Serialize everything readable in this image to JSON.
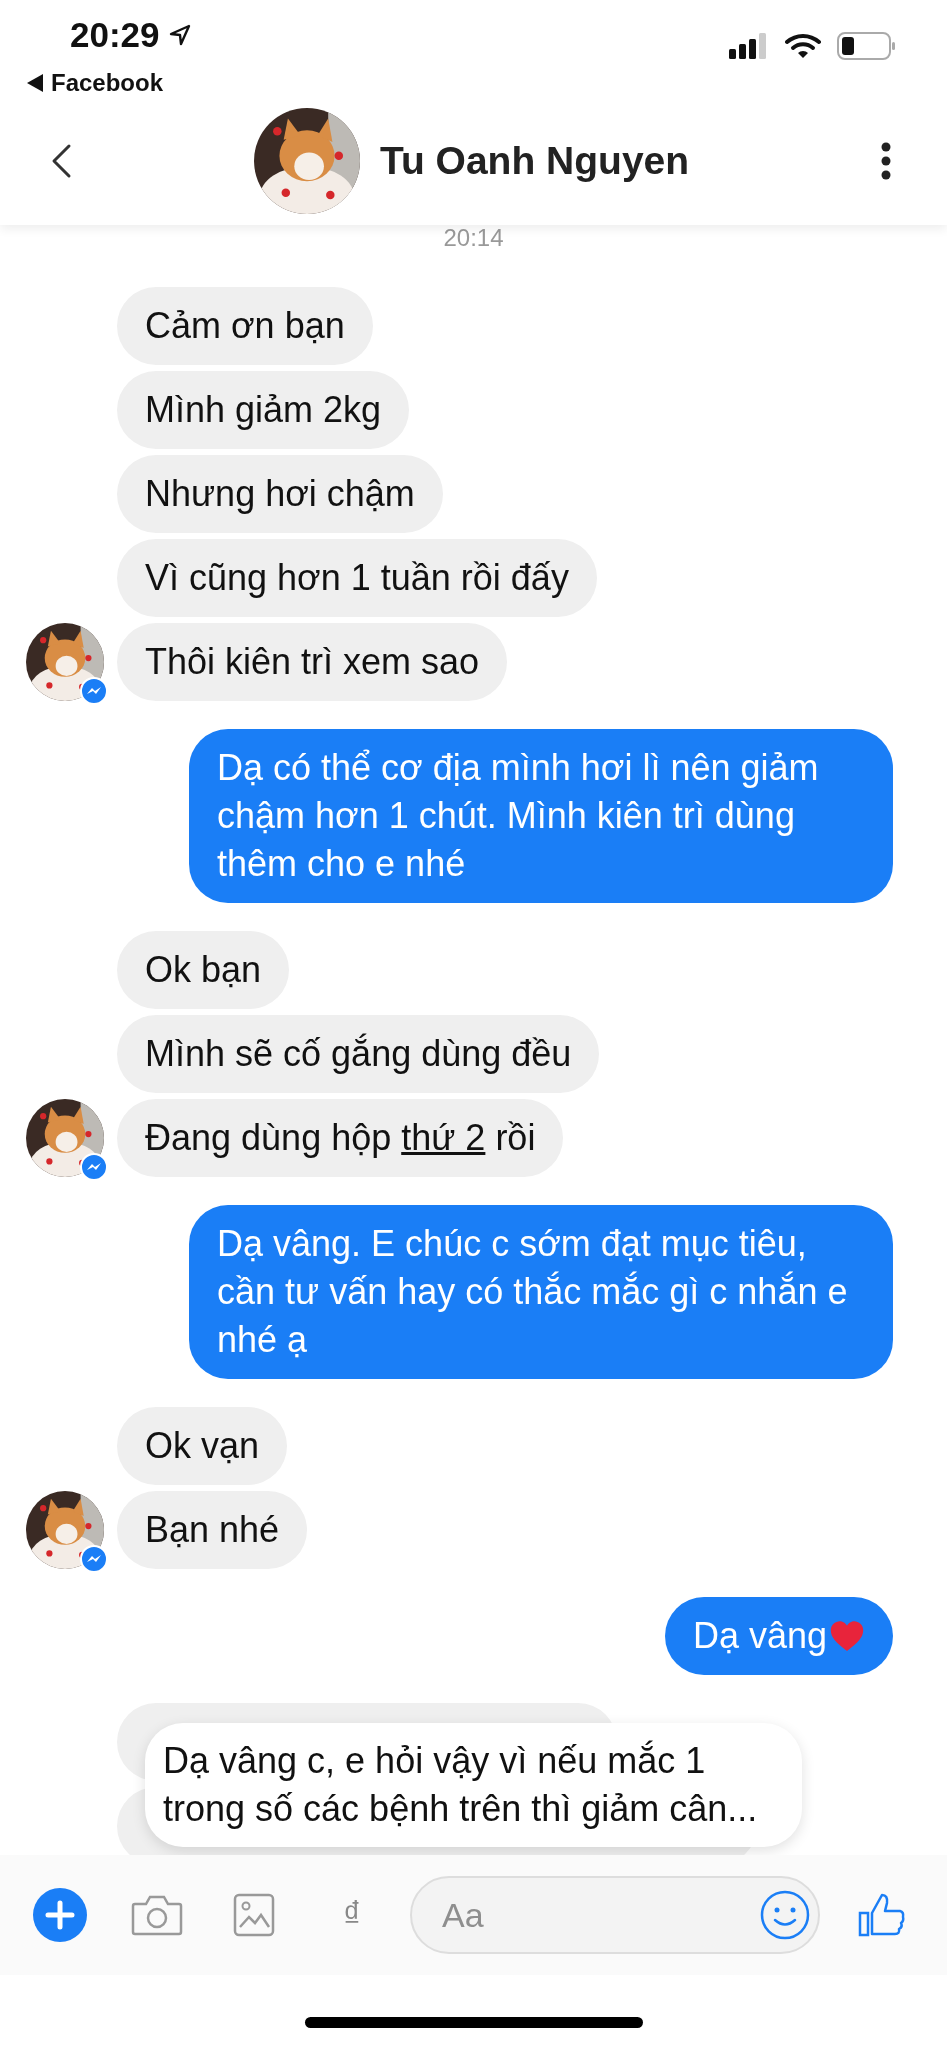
{
  "status_bar": {
    "time": "20:29",
    "back_app": "Facebook"
  },
  "header": {
    "contact_name": "Tu Oanh Nguyen"
  },
  "timestamp": "20:14",
  "groups": [
    {
      "kind": "incoming",
      "messages": [
        {
          "parts": [
            {
              "text": "Cảm ơn bạn"
            }
          ]
        },
        {
          "parts": [
            {
              "text": "Mình giảm 2kg"
            }
          ]
        },
        {
          "parts": [
            {
              "text": "Nhưng hơi chậm"
            }
          ]
        },
        {
          "parts": [
            {
              "text": "Vì cũng hơn 1 tuần rồi đấy"
            }
          ]
        },
        {
          "parts": [
            {
              "text": "Thôi kiên trì xem sao"
            }
          ]
        }
      ]
    },
    {
      "kind": "outgoing",
      "messages": [
        {
          "parts": [
            {
              "text": "Dạ có thể cơ địa mình hơi lì nên giảm chậm hơn 1 chút. Mình kiên trì dùng thêm cho e nhé"
            }
          ]
        }
      ]
    },
    {
      "kind": "incoming",
      "messages": [
        {
          "parts": [
            {
              "text": "Ok bạn"
            }
          ]
        },
        {
          "parts": [
            {
              "text": "Mình sẽ cố gắng dùng đều"
            }
          ]
        },
        {
          "parts": [
            {
              "text": "Đang dùng hộp "
            },
            {
              "text": "thứ 2",
              "kind": "link"
            },
            {
              "text": " rồi"
            }
          ]
        }
      ]
    },
    {
      "kind": "outgoing",
      "messages": [
        {
          "parts": [
            {
              "text": "Dạ vâng. E chúc c sớm đạt mục tiêu, cần tư vấn hay có thắc mắc gì c nhắn e nhé ạ"
            }
          ]
        }
      ]
    },
    {
      "kind": "incoming",
      "messages": [
        {
          "parts": [
            {
              "text": "Ok vạn"
            }
          ]
        },
        {
          "parts": [
            {
              "text": "Bạn nhé"
            }
          ]
        }
      ]
    },
    {
      "kind": "outgoing",
      "messages": [
        {
          "parts": [
            {
              "text": "Dạ vâng"
            },
            {
              "kind": "heart_emoji"
            }
          ]
        }
      ]
    }
  ],
  "notification": {
    "text": "Dạ vâng c, e hỏi vậy vì nếu mắc 1\ntrong số các bệnh trên thì giảm cân..."
  },
  "composer": {
    "currency_symbol": "₫",
    "placeholder": "Aa"
  }
}
